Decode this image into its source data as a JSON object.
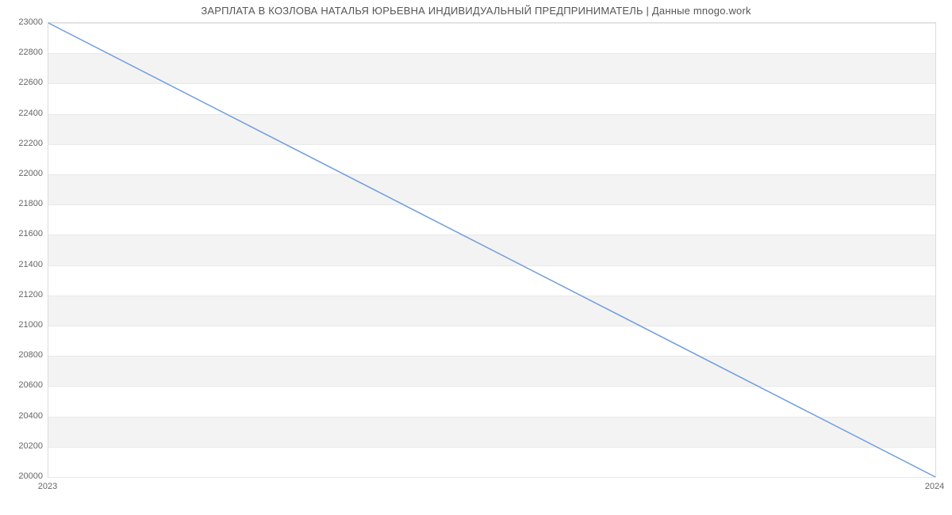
{
  "chart_data": {
    "type": "line",
    "title": "ЗАРПЛАТА В КОЗЛОВА НАТАЛЬЯ ЮРЬЕВНА ИНДИВИДУАЛЬНЫЙ ПРЕДПРИНИМАТЕЛЬ | Данные mnogo.work",
    "xlabel": "",
    "ylabel": "",
    "x": [
      2023,
      2024
    ],
    "values": [
      23000,
      20000
    ],
    "x_ticks": [
      2023,
      2024
    ],
    "y_ticks": [
      20000,
      20200,
      20400,
      20600,
      20800,
      21000,
      21200,
      21400,
      21600,
      21800,
      22000,
      22200,
      22400,
      22600,
      22800,
      23000
    ],
    "xlim": [
      2023,
      2024
    ],
    "ylim": [
      20000,
      23000
    ],
    "line_color": "#6f9ddd",
    "band_color": "#f3f3f3"
  }
}
